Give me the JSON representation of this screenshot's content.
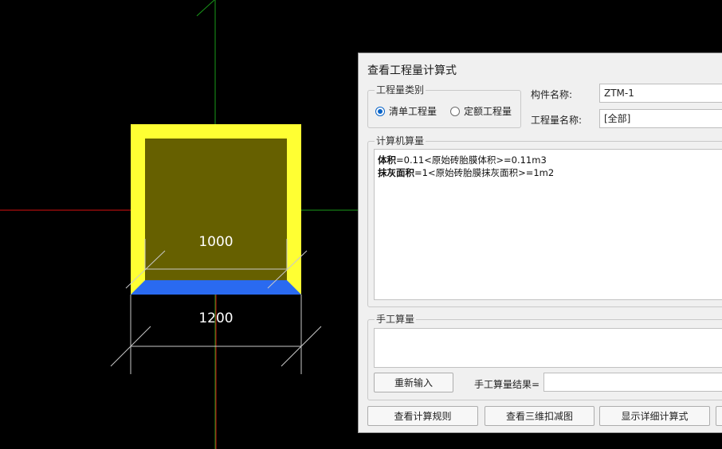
{
  "cad": {
    "dim_inner": "1000",
    "dim_outer": "1200",
    "colors": {
      "background": "#000000",
      "outer_fill": "#ffff33",
      "inner_fill": "#666000",
      "base_fill": "#2a6af0",
      "axis_red": "#d81010",
      "axis_green": "#1a9a1a"
    }
  },
  "dialog": {
    "title": "查看工程量计算式",
    "quantity_type": {
      "label": "工程量类别",
      "options": [
        "清单工程量",
        "定额工程量"
      ],
      "selected": "清单工程量"
    },
    "component_name_label": "构件名称:",
    "component_name_value": "ZTM-1",
    "quantity_name_label": "工程量名称:",
    "quantity_name_value": "[全部]",
    "computer_calc": {
      "label": "计算机算量",
      "lines": [
        {
          "key": "体积",
          "expr": "=0.11<原始砖胎膜体积>=0.11m3"
        },
        {
          "key": "抹灰面积",
          "expr": "=1<原始砖胎膜抹灰面积>=1m2"
        }
      ]
    },
    "manual_calc": {
      "label": "手工算量",
      "reenter_button": "重新输入",
      "result_label": "手工算量结果=",
      "result_value": ""
    },
    "buttons": {
      "view_rules": "查看计算规则",
      "view_3d": "查看三维扣减图",
      "show_detail": "显示详细计算式"
    }
  }
}
